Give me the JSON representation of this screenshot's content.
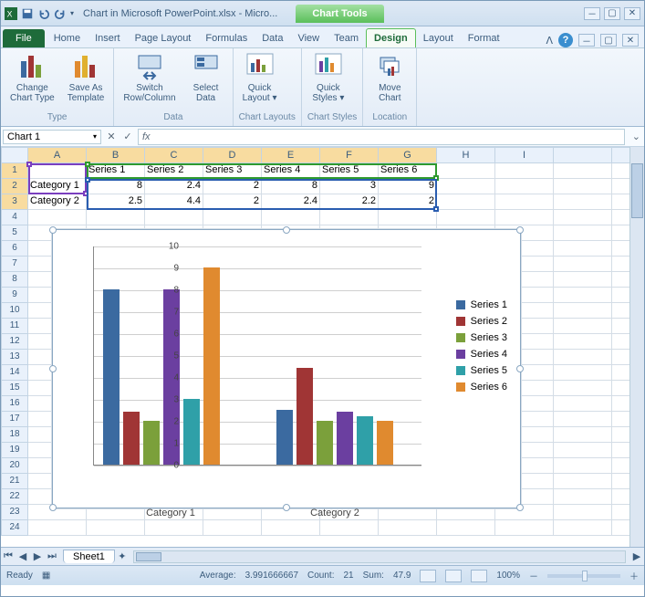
{
  "window": {
    "title": "Chart in Microsoft PowerPoint.xlsx - Micro...",
    "tools_title": "Chart Tools"
  },
  "tabs": {
    "file": "File",
    "list": [
      "Home",
      "Insert",
      "Page Layout",
      "Formulas",
      "Data",
      "View",
      "Team"
    ],
    "context": [
      "Design",
      "Layout",
      "Format"
    ],
    "active": "Design"
  },
  "ribbon": {
    "groups": [
      {
        "label": "Type",
        "buttons": [
          {
            "label": "Change\nChart Type",
            "name": "change-chart-type-button"
          },
          {
            "label": "Save As\nTemplate",
            "name": "save-as-template-button"
          }
        ]
      },
      {
        "label": "Data",
        "buttons": [
          {
            "label": "Switch\nRow/Column",
            "name": "switch-row-column-button"
          },
          {
            "label": "Select\nData",
            "name": "select-data-button"
          }
        ]
      },
      {
        "label": "Chart Layouts",
        "buttons": [
          {
            "label": "Quick\nLayout ▾",
            "name": "quick-layout-button"
          }
        ]
      },
      {
        "label": "Chart Styles",
        "buttons": [
          {
            "label": "Quick\nStyles ▾",
            "name": "quick-styles-button"
          }
        ]
      },
      {
        "label": "Location",
        "buttons": [
          {
            "label": "Move\nChart",
            "name": "move-chart-button"
          }
        ]
      }
    ]
  },
  "namebox": "Chart 1",
  "formula": "",
  "columns": [
    "A",
    "B",
    "C",
    "D",
    "E",
    "F",
    "G",
    "H",
    "I"
  ],
  "rows": 24,
  "cells": {
    "B1": "Series 1",
    "C1": "Series 2",
    "D1": "Series 3",
    "E1": "Series 4",
    "F1": "Series 5",
    "G1": "Series 6",
    "A2": "Category 1",
    "B2": "8",
    "C2": "2.4",
    "D2": "2",
    "E2": "8",
    "F2": "3",
    "G2": "9",
    "A3": "Category 2",
    "B3": "2.5",
    "C3": "4.4",
    "D3": "2",
    "E3": "2.4",
    "F3": "2.2",
    "G3": "2"
  },
  "chart_data": {
    "type": "bar",
    "categories": [
      "Category 1",
      "Category 2"
    ],
    "series": [
      {
        "name": "Series 1",
        "values": [
          8,
          2.5
        ],
        "color": "#3b6aa0"
      },
      {
        "name": "Series 2",
        "values": [
          2.4,
          4.4
        ],
        "color": "#a03535"
      },
      {
        "name": "Series 3",
        "values": [
          2,
          2
        ],
        "color": "#7ba03b"
      },
      {
        "name": "Series 4",
        "values": [
          8,
          2.4
        ],
        "color": "#6b3fa0"
      },
      {
        "name": "Series 5",
        "values": [
          3,
          2.2
        ],
        "color": "#2fa0a8"
      },
      {
        "name": "Series 6",
        "values": [
          9,
          2
        ],
        "color": "#e08a2f"
      }
    ],
    "ylim": [
      0,
      10
    ],
    "yticks": [
      0,
      1,
      2,
      3,
      4,
      5,
      6,
      7,
      8,
      9,
      10
    ],
    "title": "",
    "xlabel": "",
    "ylabel": ""
  },
  "sheet_tab": "Sheet1",
  "statusbar": {
    "state": "Ready",
    "average_label": "Average:",
    "average": "3.991666667",
    "count_label": "Count:",
    "count": "21",
    "sum_label": "Sum:",
    "sum": "47.9",
    "zoom": "100%"
  },
  "icons": {
    "dropdown": "▾",
    "minimize": "▭",
    "maximize": "▢",
    "close": "✕",
    "plus": "＋",
    "minus": "－",
    "macro": "▦"
  }
}
